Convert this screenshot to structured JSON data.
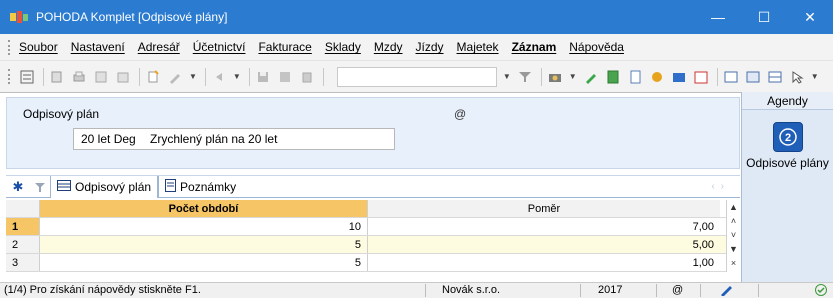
{
  "window": {
    "title": "POHODA Komplet   [Odpisové plány]",
    "minimize": "—",
    "maximize": "☐",
    "close": "✕"
  },
  "menu": {
    "items": [
      "Soubor",
      "Nastavení",
      "Adresář",
      "Účetnictví",
      "Fakturace",
      "Sklady",
      "Mzdy",
      "Jízdy",
      "Majetek",
      "Záznam",
      "Nápověda"
    ]
  },
  "form": {
    "label": "Odpisový plán",
    "at_symbol": "@",
    "code": "20 let Deg",
    "name": "Zrychlený plán na 20 let"
  },
  "tabs": {
    "star": "✱",
    "items": [
      "Odpisový plán",
      "Poznámky"
    ]
  },
  "grid": {
    "columns": [
      "Počet období",
      "Poměr"
    ],
    "rows": [
      {
        "num": "1",
        "pocet": "10",
        "pomer": "7,00"
      },
      {
        "num": "2",
        "pocet": "5",
        "pomer": "5,00"
      },
      {
        "num": "3",
        "pocet": "5",
        "pomer": "1,00"
      }
    ]
  },
  "agendy": {
    "title": "Agendy",
    "item_label": "Odpisové plány"
  },
  "status": {
    "help": "(1/4) Pro získání nápovědy stiskněte F1.",
    "company": "Novák s.r.o.",
    "year": "2017",
    "at": "@"
  },
  "colors": {
    "titlebar": "#2b7bd1",
    "selected_header": "#f5c566",
    "row_alt": "#fdfbe0"
  }
}
